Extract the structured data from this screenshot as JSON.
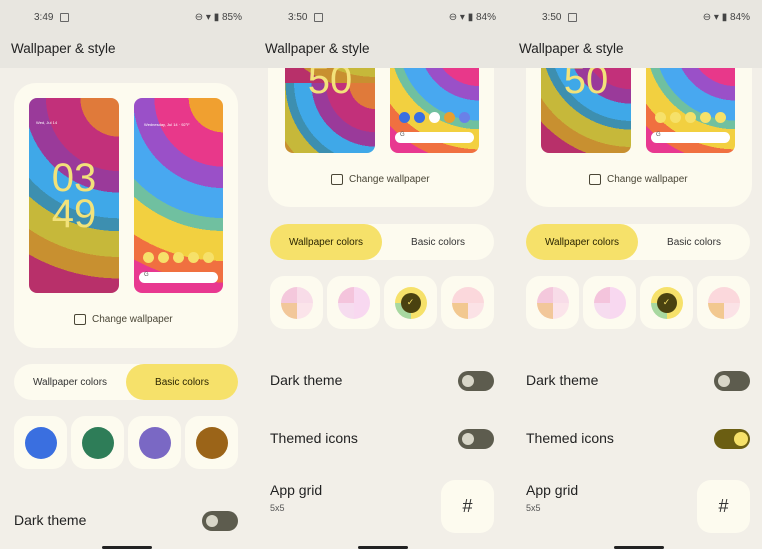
{
  "screens": [
    {
      "status": {
        "time": "3:49",
        "battery": "85%"
      },
      "title": "Wallpaper & style",
      "lock_date": "Wed, Jul 14",
      "home_date": "Wednesday, Jul 14 · 92°F",
      "clock": [
        "03",
        "49"
      ],
      "change_wallpaper": "Change wallpaper",
      "tabs": [
        "Wallpaper colors",
        "Basic colors"
      ],
      "active_tab": 1,
      "swatches": [
        "#3a6fe0",
        "#2e7d58",
        "#7a68c4",
        "#9b6418"
      ],
      "dark_theme": {
        "label": "Dark theme",
        "on": false
      }
    },
    {
      "status": {
        "time": "3:50",
        "battery": "84%"
      },
      "title": "Wallpaper & style",
      "clock_partial": "50",
      "change_wallpaper": "Change wallpaper",
      "tabs": [
        "Wallpaper colors",
        "Basic colors"
      ],
      "active_tab": 0,
      "selected_swatch": 2,
      "dark_theme": {
        "label": "Dark theme",
        "on": false
      },
      "themed_icons": {
        "label": "Themed icons",
        "on": false
      },
      "app_grid": {
        "label": "App grid",
        "value": "5x5"
      }
    },
    {
      "status": {
        "time": "3:50",
        "battery": "84%"
      },
      "title": "Wallpaper & style",
      "clock_partial": "50",
      "change_wallpaper": "Change wallpaper",
      "tabs": [
        "Wallpaper colors",
        "Basic colors"
      ],
      "active_tab": 0,
      "selected_swatch": 2,
      "dark_theme": {
        "label": "Dark theme",
        "on": false
      },
      "themed_icons": {
        "label": "Themed icons",
        "on": true
      },
      "app_grid": {
        "label": "App grid",
        "value": "5x5"
      }
    }
  ],
  "icons": {
    "grid": "#",
    "check": "✓",
    "search": "G"
  },
  "colors": {
    "accent": "#f6e16a",
    "card": "#fdfbef",
    "background": "#f2efe8"
  }
}
